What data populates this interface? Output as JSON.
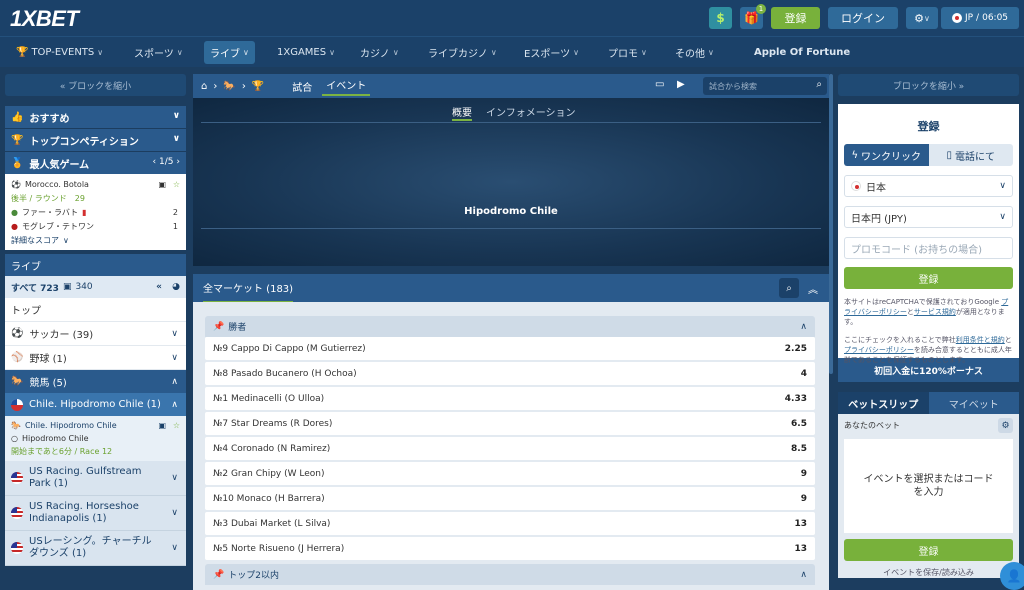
{
  "brand": {
    "logo_one": "1X",
    "logo_bet": "BET"
  },
  "topbar": {
    "register": "登録",
    "login": "ログイン",
    "locale": "JP",
    "time": "06:05",
    "gift_badge": "1"
  },
  "nav": [
    {
      "label": "TOP-EVENTS",
      "chev": "∨"
    },
    {
      "label": "スポーツ",
      "chev": "∨"
    },
    {
      "label": "ライブ",
      "chev": "∨"
    },
    {
      "label": "1XGAMES",
      "chev": "∨"
    },
    {
      "label": "カジノ",
      "chev": "∨"
    },
    {
      "label": "ライブカジノ",
      "chev": "∨"
    },
    {
      "label": "Eスポーツ",
      "chev": "∨"
    },
    {
      "label": "プロモ",
      "chev": "∨"
    },
    {
      "label": "その他",
      "chev": "∨"
    },
    {
      "label": "Apple Of Fortune",
      "chev": ""
    }
  ],
  "left": {
    "collapse": "« ブロックを縮小",
    "recommended": "おすすめ",
    "top_comp": "トップコンペティション",
    "popular": "最人気ゲーム",
    "popular_page": "1/5",
    "match": {
      "league": "Morocco. Botola",
      "stage": "後半 / ラウンド",
      "stage_num": "29",
      "team1": "ファー・ラバト",
      "score1": "2",
      "team2": "モグレブ・テトワン",
      "score2": "1",
      "detail": "詳細なスコア"
    },
    "live": "ライブ",
    "all": "すべて 723",
    "all_video": "340",
    "top": "トップ",
    "soccer": "サッカー (39)",
    "baseball": "野球 (1)",
    "horse": "競馬 (5)",
    "chile": "Chile. Hipodromo Chile (1)",
    "sub": {
      "league": "Chile. Hipodromo Chile",
      "name": "Hipodromo Chile",
      "start": "開始まであと6分 / Race 12"
    },
    "races": [
      "US Racing. Gulfstream Park (1)",
      "US Racing. Horseshoe Indianapolis (1)",
      "USレーシング。チャーチル ダウンズ (1)"
    ]
  },
  "main": {
    "tab_match": "試合",
    "tab_event": "イベント",
    "search_placeholder": "試合から検索",
    "hero_tab1": "概要",
    "hero_tab2": "インフォメーション",
    "hero_title": "Hipodromo Chile",
    "markets": "全マーケット (183)",
    "group_winner": "勝者",
    "runners": [
      {
        "name": "№9 Cappo Di Cappo (M Gutierrez)",
        "odd": "2.25"
      },
      {
        "name": "№8 Pasado Bucanero (H Ochoa)",
        "odd": "4"
      },
      {
        "name": "№1 Medinacelli (O Ulloa)",
        "odd": "4.33"
      },
      {
        "name": "№7 Star Dreams (R Dores)",
        "odd": "6.5"
      },
      {
        "name": "№4 Coronado (N Ramirez)",
        "odd": "8.5"
      },
      {
        "name": "№2 Gran Chipy (W Leon)",
        "odd": "9"
      },
      {
        "name": "№10 Monaco (H Barrera)",
        "odd": "9"
      },
      {
        "name": "№3 Dubai Market (L Silva)",
        "odd": "13"
      },
      {
        "name": "№5 Norte Risueno (J Herrera)",
        "odd": "13"
      }
    ],
    "group_top2": "トップ2以内"
  },
  "right": {
    "collapse": "ブロックを縮小 »",
    "reg_title": "登録",
    "one_click": "ワンクリック",
    "by_phone": "電話にて",
    "country": "日本",
    "currency": "日本円 (JPY)",
    "promo_placeholder": "プロモコード (お持ちの場合)",
    "reg_btn": "登録",
    "recaptcha1": "本サイトはreCAPTCHAで保護されておりGoogle ",
    "recaptcha_link1": "プライバシーポリシー",
    "recaptcha_and": "と",
    "recaptcha_link2": "サービス規約",
    "recaptcha2": "が適用となります。",
    "terms1": "ここにチェックを入れることで弊社",
    "terms_link1": "利用条件と規約",
    "terms_and": "と",
    "terms_link2": "プライバシーポリシー",
    "terms2": "を読み合意するとともに成人年齢であることを保証するものとします。",
    "bonus": "初回入金に120%ボーナス",
    "betslip": "ベットスリップ",
    "mybets": "マイベット",
    "your_bet": "あなたのベット",
    "empty": "イベントを選択またはコードを入力",
    "bs_reg": "登録",
    "save": "イベントを保存/読み込み"
  },
  "colors": {
    "accent_green": "#78b13b",
    "header_blue": "#1b4169",
    "panel_blue": "#2a5a8c"
  }
}
